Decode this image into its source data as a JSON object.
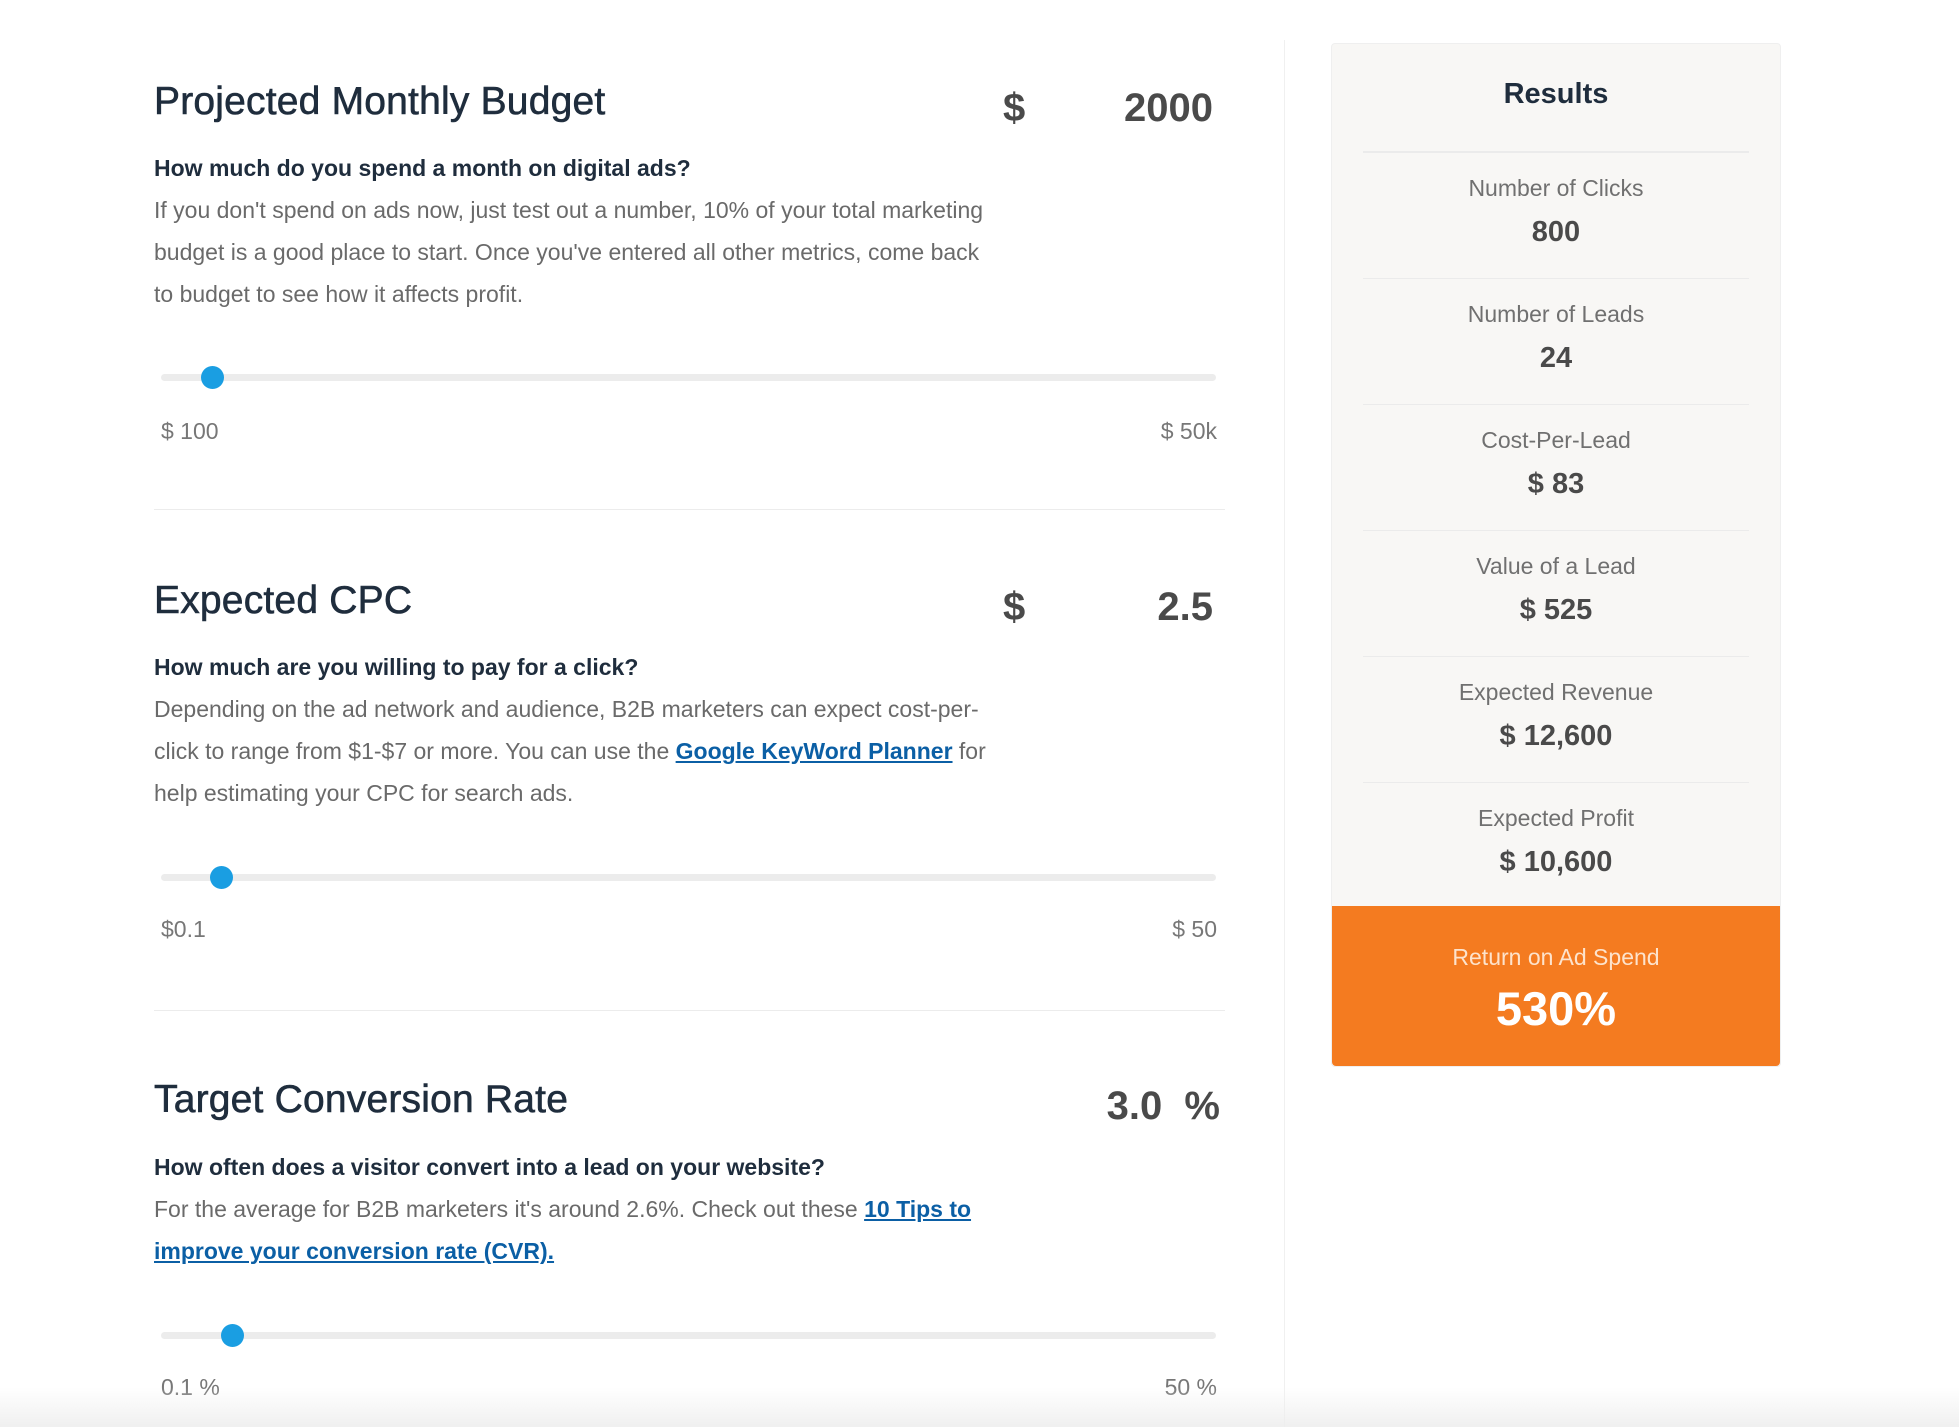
{
  "sections": [
    {
      "title": "Projected Monthly Budget",
      "currency": "$",
      "value": "2000",
      "unit": "",
      "question": "How much do you spend a month on digital ads?",
      "description": "If you don't spend on ads now, just test out a number, 10% of your total marketing budget is a good place to start. Once you've entered all other metrics, come back to budget to see how it affects profit.",
      "slider": {
        "min_label": "$ 100",
        "max_label": "$ 50k",
        "position_fraction": 0.048
      }
    },
    {
      "title": "Expected CPC",
      "currency": "$",
      "value": "2.5",
      "unit": "",
      "question": "How much are you willing to pay for a click?",
      "description_before": "Depending on the ad network and audience, B2B marketers can expect cost-per-click to range from $1-$7 or more. You can use the ",
      "link": "Google KeyWord Planner",
      "description_after": " for help estimating your CPC for search ads.",
      "slider": {
        "min_label": "$0.1",
        "max_label": "$ 50",
        "position_fraction": 0.057
      }
    },
    {
      "title": "Target Conversion Rate",
      "currency": "",
      "value": "3.0",
      "unit": "%",
      "question": "How often does a visitor convert into a lead on your website?",
      "description_before": "For the average for B2B marketers it's around 2.6%. Check out these ",
      "link": "10 Tips to improve your conversion rate (CVR).",
      "description_after": "",
      "slider": {
        "min_label": "0.1 %",
        "max_label": "50 %",
        "position_fraction": 0.067
      }
    }
  ],
  "results": {
    "title": "Results",
    "rows": [
      {
        "label": "Number of Clicks",
        "value": "800"
      },
      {
        "label": "Number of Leads",
        "value": "24"
      },
      {
        "label": "Cost-Per-Lead",
        "value": "$ 83"
      },
      {
        "label": "Value of a Lead",
        "value": "$ 525"
      },
      {
        "label": "Expected Revenue",
        "value": "$ 12,600"
      },
      {
        "label": "Expected Profit",
        "value": "$ 10,600"
      }
    ],
    "roas": {
      "label": "Return on Ad Spend",
      "value": "530%"
    }
  },
  "colors": {
    "accent_blue": "#1a9ee2",
    "link_blue": "#0b5fa5",
    "roas_orange": "#f47b20",
    "heading": "#1f2d3d"
  }
}
